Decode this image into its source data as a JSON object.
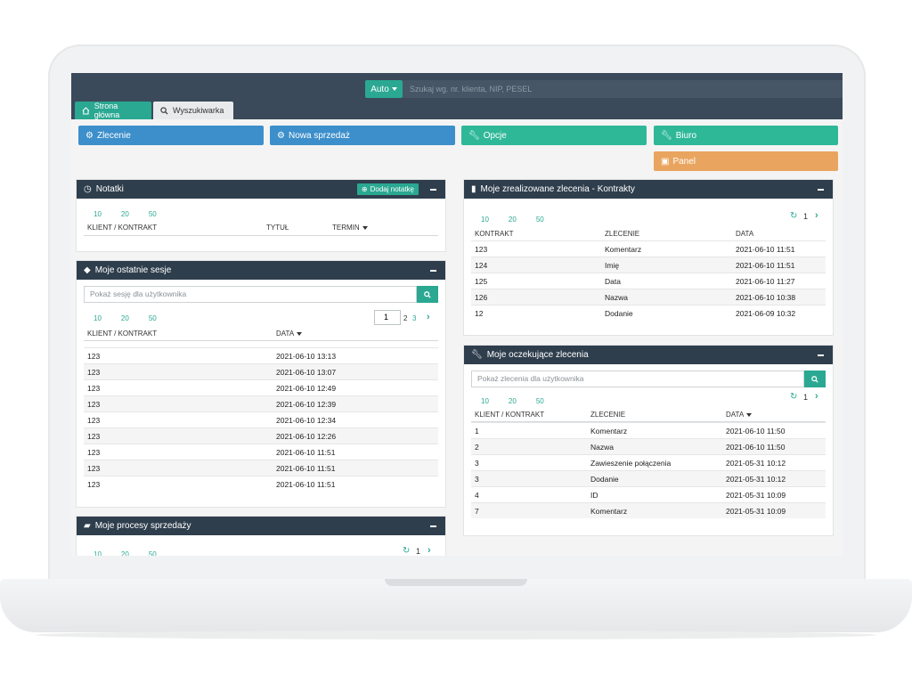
{
  "topbar": {
    "auto_label": "Auto",
    "search_placeholder": "Szukaj wg. nr. klienta, NIP, PESEL"
  },
  "tabs": [
    {
      "label": "Strona główna"
    },
    {
      "label": "Wyszukiwarka"
    }
  ],
  "actions": {
    "zlecenie": "Zlecenie",
    "nowa_sprzedaz": "Nowa sprzedaż",
    "opcje": "Opcje",
    "biuro": "Biuro",
    "panel": "Panel"
  },
  "colors": {
    "accent": "#2aa892",
    "blue": "#3d8fcb",
    "orange": "#e9a55f",
    "dark": "#2f3e4d"
  },
  "pager_sizes": [
    "10",
    "20",
    "50"
  ],
  "notatki": {
    "title": "Notatki",
    "add_label": "Dodaj notatkę",
    "columns": [
      "KLIENT / KONTRAKT",
      "TYTUŁ",
      "TERMIN"
    ]
  },
  "sesje": {
    "title": "Moje ostatnie sesje",
    "search_placeholder": "Pokaż sesję dla użytkownika",
    "page_input": "1",
    "pages": [
      "2",
      "3"
    ],
    "columns": [
      "KLIENT / KONTRAKT",
      "DATA"
    ],
    "rows": [
      {
        "client": "123",
        "date": "2021-06-10 13:13"
      },
      {
        "client": "123",
        "date": "2021-06-10 13:07"
      },
      {
        "client": "123",
        "date": "2021-06-10 12:49"
      },
      {
        "client": "123",
        "date": "2021-06-10 12:39"
      },
      {
        "client": "123",
        "date": "2021-06-10 12:34"
      },
      {
        "client": "123",
        "date": "2021-06-10 12:26"
      },
      {
        "client": "123",
        "date": "2021-06-10 11:51"
      },
      {
        "client": "123",
        "date": "2021-06-10 11:51"
      },
      {
        "client": "123",
        "date": "2021-06-10 11:51"
      }
    ]
  },
  "procesy": {
    "title": "Moje procesy sprzedaży",
    "page": "1"
  },
  "zrealizowane": {
    "title": "Moje zrealizowane zlecenia - Kontrakty",
    "page": "1",
    "columns": [
      "KONTRAKT",
      "ZLECENIE",
      "DATA"
    ],
    "rows": [
      {
        "kontrakt": "123",
        "zlecenie": "Komentarz",
        "date": "2021-06-10 11:51"
      },
      {
        "kontrakt": "124",
        "zlecenie": "Imię",
        "date": "2021-06-10 11:51"
      },
      {
        "kontrakt": "125",
        "zlecenie": "Data",
        "date": "2021-06-10 11:27"
      },
      {
        "kontrakt": "126",
        "zlecenie": "Nazwa",
        "date": "2021-06-10 10:38"
      },
      {
        "kontrakt": "12",
        "zlecenie": "Dodanie",
        "date": "2021-06-09 10:32"
      }
    ]
  },
  "oczekujace": {
    "title": "Moje oczekujące zlecenia",
    "search_placeholder": "Pokaż zlecenia dla użytkownika",
    "page": "1",
    "columns": [
      "KLIENT / KONTRAKT",
      "ZLECENIE",
      "DATA"
    ],
    "rows": [
      {
        "client": "1",
        "zlecenie": "Komentarz",
        "date": "2021-06-10 11:50"
      },
      {
        "client": "2",
        "zlecenie": "Nazwa",
        "date": "2021-06-10 11:50"
      },
      {
        "client": "3",
        "zlecenie": "Zawieszenie połączenia",
        "date": "2021-05-31 10:12"
      },
      {
        "client": "3",
        "zlecenie": "Dodanie",
        "date": "2021-05-31 10:12"
      },
      {
        "client": "4",
        "zlecenie": "ID",
        "date": "2021-05-31 10:09"
      },
      {
        "client": "7",
        "zlecenie": "Komentarz",
        "date": "2021-05-31 10:09"
      }
    ]
  }
}
